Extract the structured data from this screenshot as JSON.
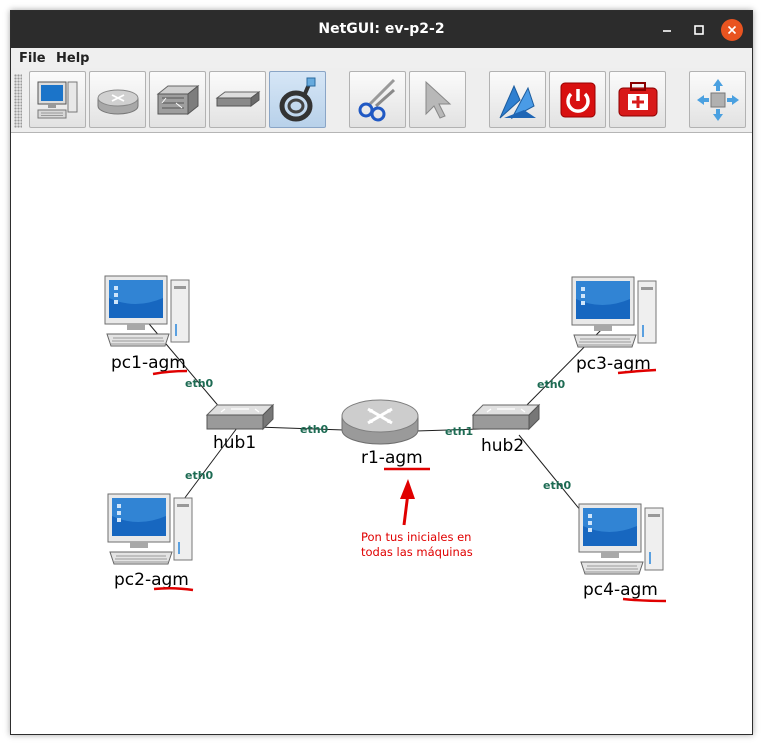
{
  "window": {
    "title": "NetGUI: ev-p2-2"
  },
  "menu": [
    {
      "label": "File"
    },
    {
      "label": "Help"
    }
  ],
  "toolbar": {
    "buttons": [
      {
        "name": "add-terminal-button",
        "icon": "computer-icon",
        "active": false
      },
      {
        "name": "add-router-button",
        "icon": "router-icon",
        "active": false
      },
      {
        "name": "add-switch-button",
        "icon": "switch-icon",
        "active": false
      },
      {
        "name": "add-hub-button",
        "icon": "hub-icon",
        "active": false
      },
      {
        "name": "link-tool-button",
        "icon": "cable-icon",
        "active": true
      },
      {
        "name": "delete-tool-button",
        "icon": "scissors-icon",
        "active": false
      },
      {
        "name": "select-tool-button",
        "icon": "pointer-icon",
        "active": false
      },
      {
        "name": "start-button",
        "icon": "blue-arrows-icon",
        "active": false
      },
      {
        "name": "stop-button",
        "icon": "power-icon",
        "active": false
      },
      {
        "name": "first-aid-button",
        "icon": "first-aid-icon",
        "active": false
      },
      {
        "name": "pan-button",
        "icon": "move-arrows-icon",
        "active": false
      }
    ]
  },
  "network": {
    "nodes": [
      {
        "id": "pc1",
        "label": "pc1-agm",
        "type": "terminal"
      },
      {
        "id": "pc2",
        "label": "pc2-agm",
        "type": "terminal"
      },
      {
        "id": "pc3",
        "label": "pc3-agm",
        "type": "terminal"
      },
      {
        "id": "pc4",
        "label": "pc4-agm",
        "type": "terminal"
      },
      {
        "id": "hub1",
        "label": "hub1",
        "type": "hub"
      },
      {
        "id": "hub2",
        "label": "hub2",
        "type": "hub"
      },
      {
        "id": "r1",
        "label": "r1-agm",
        "type": "router"
      }
    ],
    "interfaces": {
      "pc1": "eth0",
      "pc2": "eth0",
      "pc3": "eth0",
      "pc4": "eth0",
      "r1_left": "eth0",
      "r1_right": "eth1"
    }
  },
  "annotation": {
    "line1": "Pon tus iniciales en",
    "line2": "todas las máquinas",
    "color": "#e00000"
  },
  "colors": {
    "titlebar": "#2c2c2c",
    "close_button": "#e95420",
    "interface_label": "#1d6b53",
    "annotation": "#e00000"
  }
}
